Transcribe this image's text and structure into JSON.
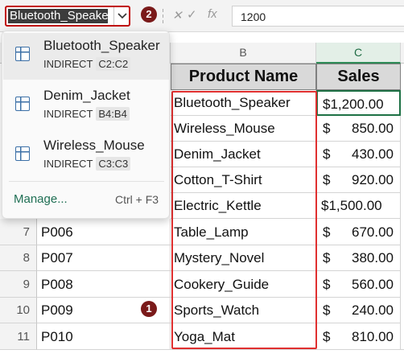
{
  "formula_bar": {
    "name_box_value": "Bluetooth_Speaker",
    "formula_value": "1200",
    "cancel_symbol": "✕",
    "enter_symbol": "✓",
    "fx_label": "fx"
  },
  "badges": [
    "2",
    "1"
  ],
  "columns": [
    "B",
    "C"
  ],
  "headers": {
    "product": "Product Name",
    "sales": "Sales"
  },
  "rows": [
    {
      "row": "7",
      "id": "P006"
    },
    {
      "row": "8",
      "id": "P007"
    },
    {
      "row": "9",
      "id": "P008"
    },
    {
      "row": "10",
      "id": "P009"
    },
    {
      "row": "11",
      "id": "P010"
    }
  ],
  "products": [
    {
      "name": "Bluetooth_Speaker",
      "symbol": "$1,200.00",
      "amount": ""
    },
    {
      "name": "Wireless_Mouse",
      "symbol": "$",
      "amount": "850.00"
    },
    {
      "name": "Denim_Jacket",
      "symbol": "$",
      "amount": "430.00"
    },
    {
      "name": "Cotton_T-Shirt",
      "symbol": "$",
      "amount": "920.00"
    },
    {
      "name": "Electric_Kettle",
      "symbol": "$1,500.00",
      "amount": ""
    },
    {
      "name": "Table_Lamp",
      "symbol": "$",
      "amount": "670.00"
    },
    {
      "name": "Mystery_Novel",
      "symbol": "$",
      "amount": "380.00"
    },
    {
      "name": "Cookery_Guide",
      "symbol": "$",
      "amount": "560.00"
    },
    {
      "name": "Sports_Watch",
      "symbol": "$",
      "amount": "240.00"
    },
    {
      "name": "Yoga_Mat",
      "symbol": "$",
      "amount": "810.00"
    }
  ],
  "name_dropdown": {
    "items": [
      {
        "name": "Bluetooth_Speaker",
        "type": "INDIRECT",
        "ref": "C2:C2"
      },
      {
        "name": "Denim_Jacket",
        "type": "INDIRECT",
        "ref": "B4:B4"
      },
      {
        "name": "Wireless_Mouse",
        "type": "INDIRECT",
        "ref": "C3:C3"
      }
    ],
    "manage_label": "Manage...",
    "manage_shortcut": "Ctrl + F3"
  },
  "colors": {
    "highlight": "#c00000",
    "badge": "#7a1a1a",
    "selected_col": "#e3efe7",
    "link": "#1f6f54"
  }
}
